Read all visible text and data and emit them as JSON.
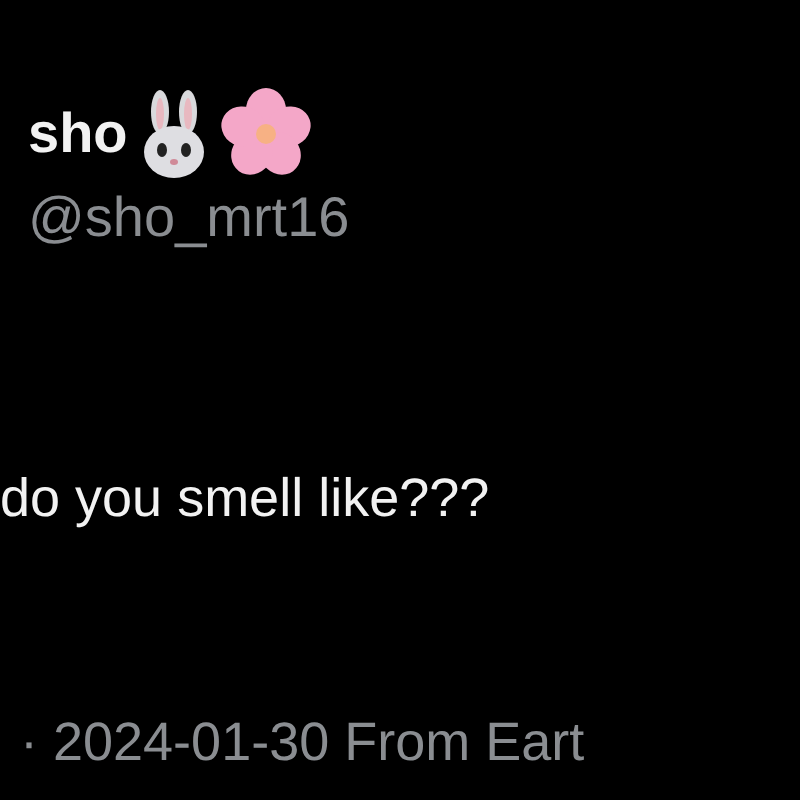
{
  "author": {
    "name": "sho",
    "handle": "@sho_mrt16"
  },
  "post": {
    "text": "do you smell like???"
  },
  "meta": {
    "text": "· 2024-01-30 From Eart"
  }
}
